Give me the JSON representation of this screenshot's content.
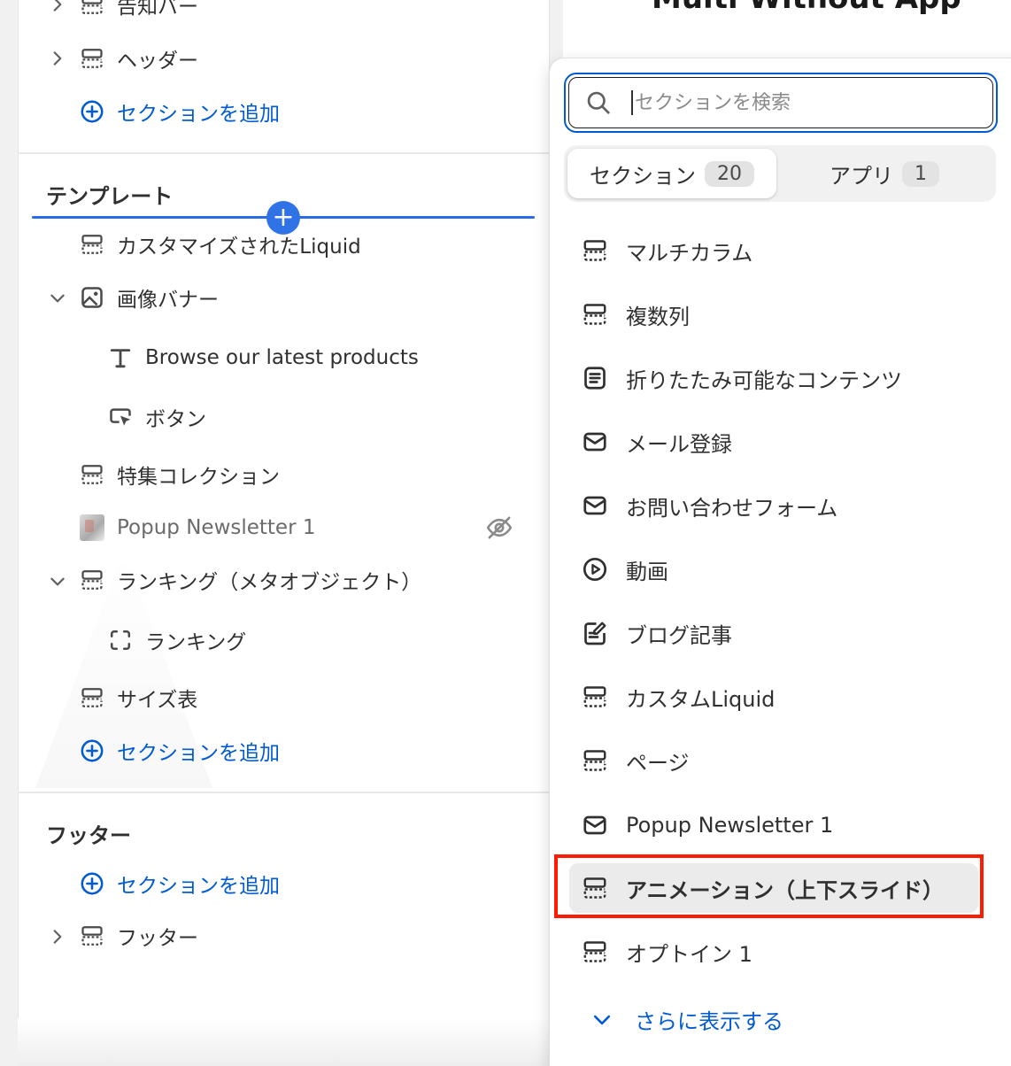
{
  "canvas": {
    "title": "Multi Without App"
  },
  "sidebar": {
    "header_group": {
      "items": [
        {
          "label": "告知バー"
        },
        {
          "label": "ヘッダー"
        }
      ],
      "add_label": "セクションを追加"
    },
    "template_group": {
      "heading": "テンプレート",
      "items": {
        "custom_liquid": "カスタマイズされたLiquid",
        "image_banner": "画像バナー",
        "browse_text": "Browse our latest products",
        "button": "ボタン",
        "featured_collection": "特集コレクション",
        "popup_newsletter": "Popup Newsletter 1",
        "ranking_meta": "ランキング（メタオブジェクト）",
        "ranking": "ランキング",
        "size_chart": "サイズ表"
      },
      "add_label": "セクションを追加"
    },
    "footer_group": {
      "heading": "フッター",
      "add_label": "セクションを追加",
      "footer_item": "フッター"
    }
  },
  "picker": {
    "search_placeholder": "セクションを検索",
    "tabs": [
      {
        "label": "セクション",
        "count": "20"
      },
      {
        "label": "アプリ",
        "count": "1"
      }
    ],
    "items": [
      {
        "label": "マルチカラム"
      },
      {
        "label": "複数列"
      },
      {
        "label": "折りたたみ可能なコンテンツ"
      },
      {
        "label": "メール登録"
      },
      {
        "label": "お問い合わせフォーム"
      },
      {
        "label": "動画"
      },
      {
        "label": "ブログ記事"
      },
      {
        "label": "カスタムLiquid"
      },
      {
        "label": "ページ"
      },
      {
        "label": "Popup Newsletter 1"
      },
      {
        "label": "アニメーション（上下スライド）"
      },
      {
        "label": "オプトイン 1"
      }
    ],
    "show_more_label": "さらに表示する"
  },
  "colors": {
    "accent": "#005bd3",
    "highlight_border": "#ff1a00",
    "drop_indicator": "#2a6be8"
  }
}
